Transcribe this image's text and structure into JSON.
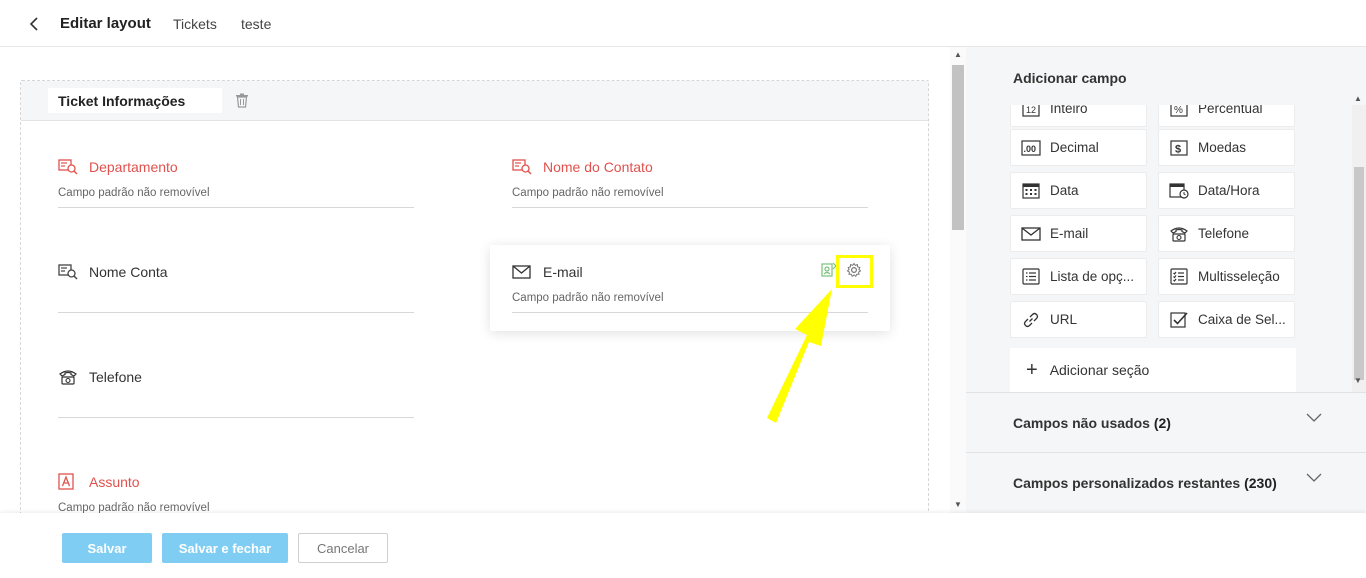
{
  "header": {
    "title": "Editar layout",
    "crumbs": [
      "Tickets",
      "teste"
    ]
  },
  "section": {
    "name": "Ticket Informações"
  },
  "fields": [
    {
      "label": "Departamento",
      "hint": "Campo padrão não removível",
      "icon": "lookup-icon",
      "required": true
    },
    {
      "label": "Nome do Contato",
      "hint": "Campo padrão não removível",
      "icon": "lookup-icon",
      "required": true
    },
    {
      "label": "Nome Conta",
      "hint": "",
      "icon": "lookup-icon",
      "required": false
    },
    {
      "label": "E-mail",
      "hint": "Campo padrão não removível",
      "icon": "envelope-icon",
      "required": false
    },
    {
      "label": "Telefone",
      "hint": "",
      "icon": "phone-icon",
      "required": false
    },
    {
      "label": "Assunto",
      "hint": "Campo padrão não removível",
      "icon": "text-field-icon",
      "required": true
    }
  ],
  "panel": {
    "title": "Adicionar campo",
    "tiles": [
      {
        "label": "Inteiro",
        "icon": "integer-icon"
      },
      {
        "label": "Percentual",
        "icon": "percent-icon"
      },
      {
        "label": "Decimal",
        "icon": "decimal-icon"
      },
      {
        "label": "Moedas",
        "icon": "currency-icon"
      },
      {
        "label": "Data",
        "icon": "calendar-icon"
      },
      {
        "label": "Data/Hora",
        "icon": "datetime-icon"
      },
      {
        "label": "E-mail",
        "icon": "envelope-icon"
      },
      {
        "label": "Telefone",
        "icon": "phone-icon"
      },
      {
        "label": "Lista de opç...",
        "icon": "picklist-icon"
      },
      {
        "label": "Multisseleção",
        "icon": "multiselect-icon"
      },
      {
        "label": "URL",
        "icon": "link-icon"
      },
      {
        "label": "Caixa de Sel...",
        "icon": "checkbox-icon"
      }
    ],
    "add_section": "Adicionar seção",
    "accordions": [
      {
        "label": "Campos não usados",
        "count": "(2)"
      },
      {
        "label": "Campos personalizados restantes",
        "count": "(230)"
      }
    ]
  },
  "footer": {
    "save": "Salvar",
    "save_close": "Salvar e fechar",
    "cancel": "Cancelar"
  },
  "colors": {
    "required_label": "#e0524d",
    "primary_button": "#7fcdf3",
    "annotation": "#ffff00"
  }
}
